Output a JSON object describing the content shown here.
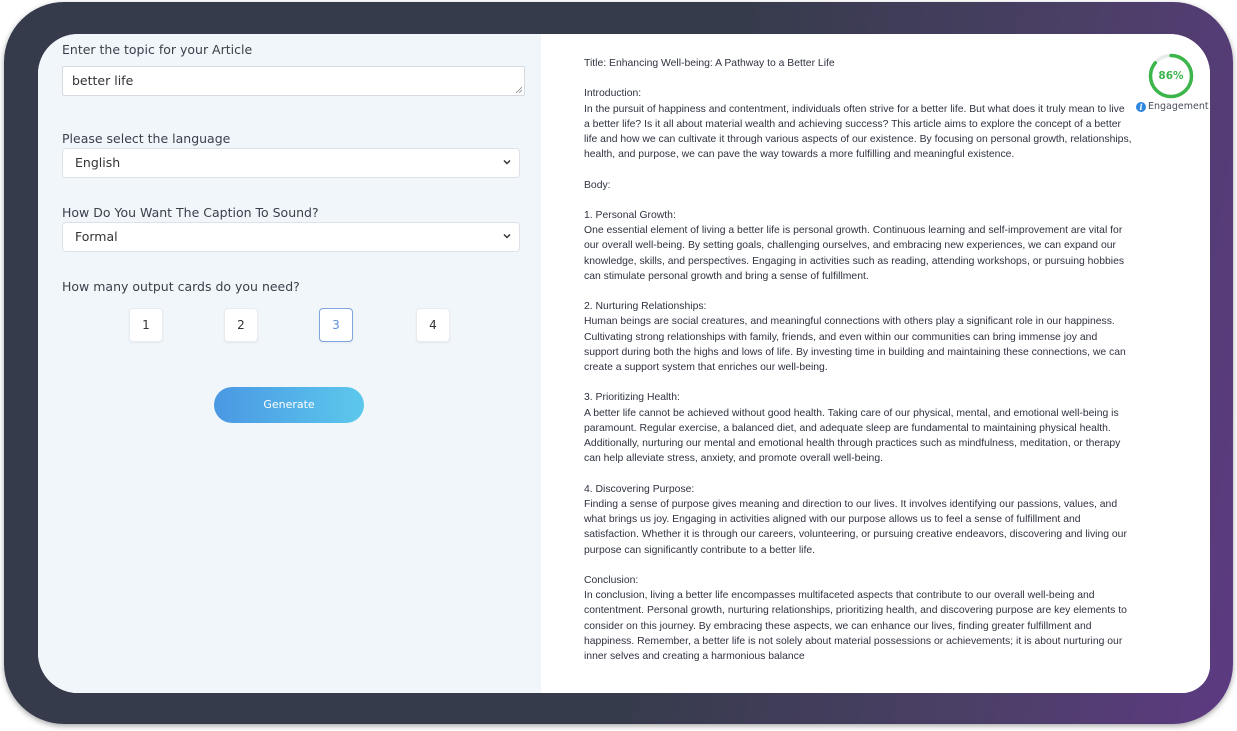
{
  "form": {
    "topic_label": "Enter the topic for your Article",
    "topic_value": "better life",
    "language_label": "Please select the language",
    "language_value": "English",
    "tone_label": "How Do You Want The Caption To Sound?",
    "tone_value": "Formal",
    "cards_label": "How many output cards do you need?",
    "card_options": [
      "1",
      "2",
      "3",
      "4"
    ],
    "selected_card": "3",
    "generate_label": "Generate"
  },
  "result": {
    "engagement_score": "86%",
    "engagement_fraction": 0.86,
    "engagement_label": "Engagement",
    "article_text": "Title: Enhancing Well-being: A Pathway to a Better Life\n\nIntroduction:\nIn the pursuit of happiness and contentment, individuals often strive for a better life. But what does it truly mean to live a better life? Is it all about material wealth and achieving success? This article aims to explore the concept of a better life and how we can cultivate it through various aspects of our existence. By focusing on personal growth, relationships, health, and purpose, we can pave the way towards a more fulfilling and meaningful existence.\n\nBody:\n\n1. Personal Growth:\nOne essential element of living a better life is personal growth. Continuous learning and self-improvement are vital for our overall well-being. By setting goals, challenging ourselves, and embracing new experiences, we can expand our knowledge, skills, and perspectives. Engaging in activities such as reading, attending workshops, or pursuing hobbies can stimulate personal growth and bring a sense of fulfillment.\n\n2. Nurturing Relationships:\nHuman beings are social creatures, and meaningful connections with others play a significant role in our happiness. Cultivating strong relationships with family, friends, and even within our communities can bring immense joy and support during both the highs and lows of life. By investing time in building and maintaining these connections, we can create a support system that enriches our well-being.\n\n3. Prioritizing Health:\nA better life cannot be achieved without good health. Taking care of our physical, mental, and emotional well-being is paramount. Regular exercise, a balanced diet, and adequate sleep are fundamental to maintaining physical health. Additionally, nurturing our mental and emotional health through practices such as mindfulness, meditation, or therapy can help alleviate stress, anxiety, and promote overall well-being.\n\n4. Discovering Purpose:\nFinding a sense of purpose gives meaning and direction to our lives. It involves identifying our passions, values, and what brings us joy. Engaging in activities aligned with our purpose allows us to feel a sense of fulfillment and satisfaction. Whether it is through our careers, volunteering, or pursuing creative endeavors, discovering and living our purpose can significantly contribute to a better life.\n\nConclusion:\nIn conclusion, living a better life encompasses multifaceted aspects that contribute to our overall well-being and contentment. Personal growth, nurturing relationships, prioritizing health, and discovering purpose are key elements to consider on this journey. By embracing these aspects, we can enhance our lives, finding greater fulfillment and happiness. Remember, a better life is not solely about material possessions or achievements; it is about nurturing our inner selves and creating a harmonious balance"
  },
  "colors": {
    "frame": "#363b4c",
    "panel_bg": "#f1f6fb",
    "accent_blue": "#4a98e3",
    "gauge_green": "#3cb54a"
  }
}
